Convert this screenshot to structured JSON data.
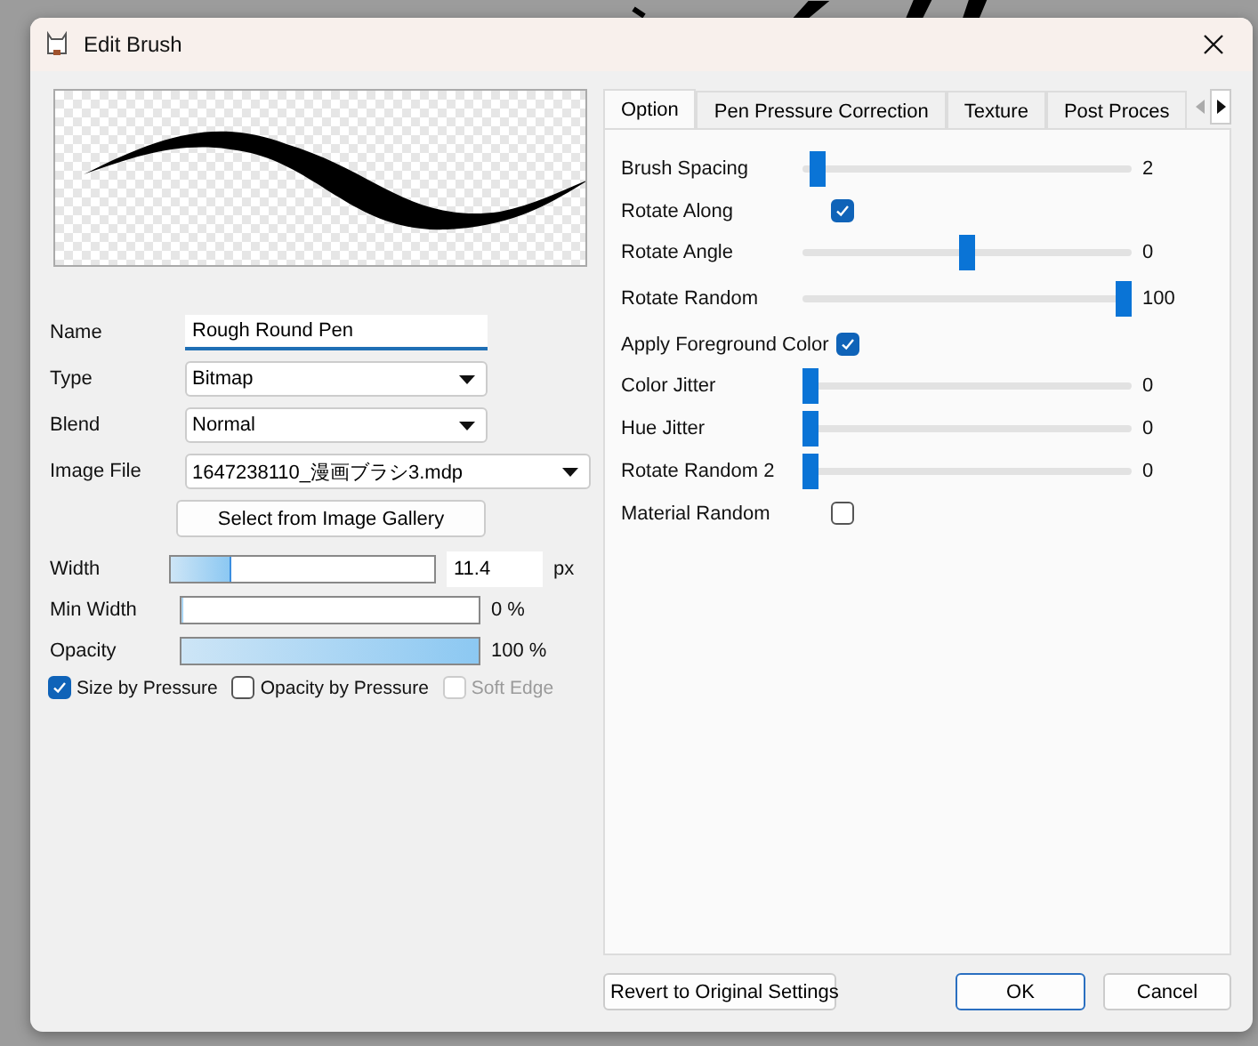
{
  "window": {
    "title": "Edit Brush"
  },
  "fields": [
    {
      "kind": "text",
      "label": "Name",
      "value": "Rough Round Pen"
    },
    {
      "kind": "select",
      "label": "Type",
      "value": "Bitmap"
    },
    {
      "kind": "select",
      "label": "Blend",
      "value": "Normal"
    },
    {
      "kind": "select",
      "label": "Image File",
      "value": "1647238110_漫画ブラシ3.mdp"
    }
  ],
  "gallery_button": "Select from Image Gallery",
  "width": {
    "label": "Width",
    "level": 0.23,
    "value": "11.4",
    "unit": "px"
  },
  "bars": [
    {
      "label": "Min Width",
      "level": 0,
      "reading": "0 %"
    },
    {
      "label": "Opacity",
      "level": 1,
      "reading": "100 %"
    }
  ],
  "options": [
    {
      "label": "Size by Pressure",
      "checked": true,
      "disabled": false
    },
    {
      "label": "Opacity by Pressure",
      "checked": false,
      "disabled": false
    },
    {
      "label": "Soft Edge",
      "checked": false,
      "disabled": true
    }
  ],
  "tabs": [
    {
      "label": "Option",
      "selected": true
    },
    {
      "label": "Pen Pressure Correction",
      "selected": false
    },
    {
      "label": "Texture",
      "selected": false
    },
    {
      "label": "Post Proces",
      "selected": false
    }
  ],
  "settings": [
    {
      "kind": "slider",
      "label": "Brush Spacing",
      "level": 0.02,
      "reading": "2"
    },
    {
      "kind": "checkbox",
      "label": "Rotate Along",
      "checked": true
    },
    {
      "kind": "slider",
      "label": "Rotate Angle",
      "level": 0.5,
      "reading": "0"
    },
    {
      "kind": "slider",
      "label": "Rotate Random",
      "level": 1,
      "reading": "100"
    },
    {
      "kind": "checkbox",
      "label": "Apply Foreground Color",
      "checked": true
    },
    {
      "kind": "slider",
      "label": "Color Jitter",
      "level": 0,
      "reading": "0"
    },
    {
      "kind": "slider",
      "label": "Hue Jitter",
      "level": 0,
      "reading": "0"
    },
    {
      "kind": "slider",
      "label": "Rotate Random 2",
      "level": 0,
      "reading": "0"
    },
    {
      "kind": "checkbox",
      "label": "Material Random",
      "checked": false
    }
  ],
  "buttons": {
    "revert": "Revert to Original Settings",
    "ok": "OK",
    "cancel": "Cancel"
  }
}
